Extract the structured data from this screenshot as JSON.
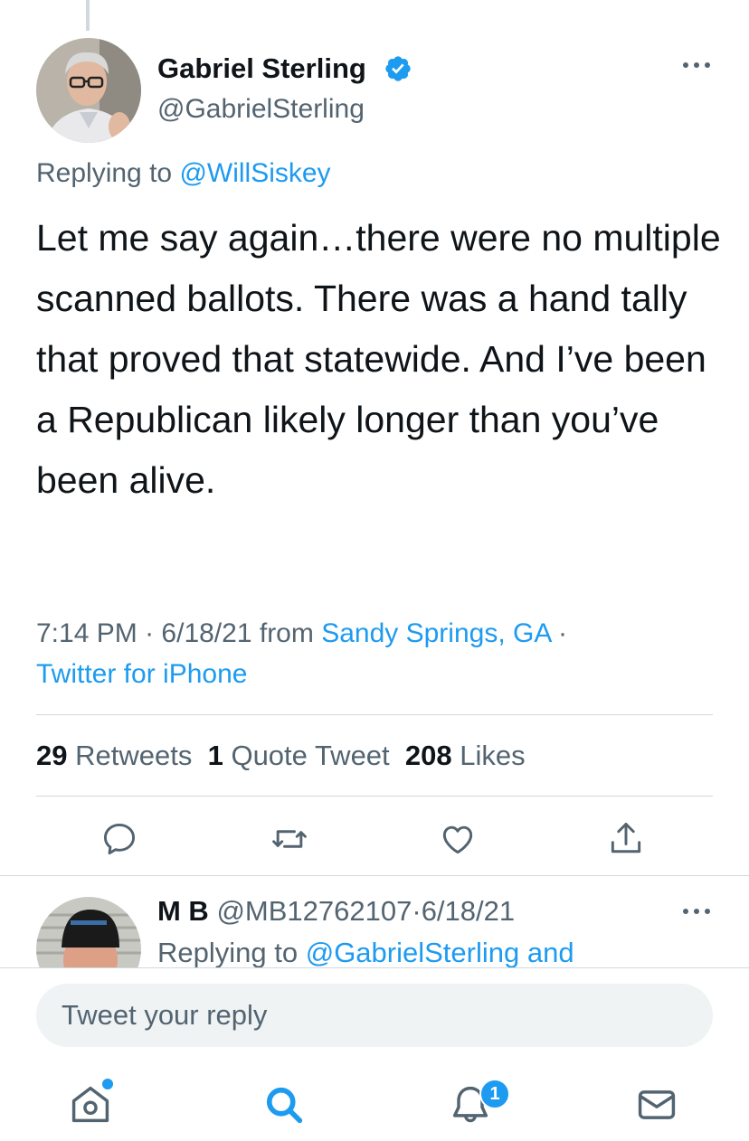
{
  "colors": {
    "accent": "#1d9bf0",
    "text": "#0f1419",
    "secondary": "#536471",
    "divider": "#cfd9de"
  },
  "tweet": {
    "author_name": "Gabriel Sterling",
    "author_handle": "@GabrielSterling",
    "replying_prefix": "Replying to",
    "replying_handle": "@WillSiskey",
    "text": "Let me say again…there were no multiple scanned ballots. There was a hand tally that proved that statewide. And I’ve been a Republican likely longer than you’ve been alive.",
    "time": "7:14 PM",
    "date": "6/18/21",
    "from_label": "from",
    "location": "Sandy Springs, GA",
    "client": "Twitter for iPhone"
  },
  "stats": {
    "retweets_count": "29",
    "retweets_label": "Retweets",
    "quotes_count": "1",
    "quotes_label": "Quote Tweet",
    "likes_count": "208",
    "likes_label": "Likes"
  },
  "actions": [
    "reply-icon",
    "retweet-icon",
    "like-icon",
    "share-icon"
  ],
  "reply": {
    "name": "M B",
    "handle": "@MB12762107",
    "date": "6/18/21",
    "replying_prefix": "Replying to",
    "replying_text": "@GabrielSterling and"
  },
  "composer": {
    "placeholder": "Tweet your reply"
  },
  "tabbar": {
    "items": [
      "home-icon",
      "search-icon",
      "notifications-icon",
      "messages-icon"
    ],
    "notification_count": "1"
  }
}
